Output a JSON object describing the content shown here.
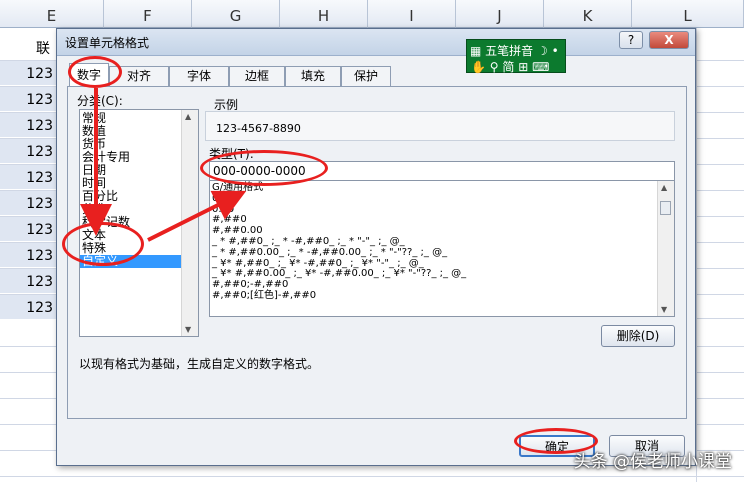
{
  "sheet": {
    "columns": [
      "E",
      "F",
      "G",
      "H",
      "I",
      "J",
      "K",
      "L"
    ],
    "header_cell": "联",
    "cells": [
      "123",
      "123",
      "123",
      "123",
      "123",
      "123",
      "123",
      "123",
      "123",
      "123"
    ]
  },
  "dialog": {
    "title": "设置单元格格式",
    "help_label": "?",
    "close_label": "X",
    "tabs": [
      "数字",
      "对齐",
      "字体",
      "边框",
      "填充",
      "保护"
    ],
    "category_label": "分类(C):",
    "categories": [
      "常规",
      "数值",
      "货币",
      "会计专用",
      "日期",
      "时间",
      "百分比",
      "分数",
      "科学记数",
      "文本",
      "特殊",
      "自定义"
    ],
    "selected_category": "自定义",
    "sample_label": "示例",
    "sample_value": "123-4567-8890",
    "type_label": "类型(T):",
    "type_value": "000-0000-0000",
    "format_list": [
      "G/通用格式",
      "0",
      "0.00",
      "#,##0",
      "#,##0.00",
      "_ * #,##0_ ;_ * -#,##0_ ;_ * \"-\"_ ;_ @_ ",
      "_ * #,##0.00_ ;_ * -#,##0.00_ ;_ * \"-\"??_ ;_ @_ ",
      "_ ¥* #,##0_ ;_ ¥* -#,##0_ ;_ ¥* \"-\"_ ;_ @_ ",
      "_ ¥* #,##0.00_ ;_ ¥* -#,##0.00_ ;_ ¥* \"-\"??_ ;_ @_ ",
      "#,##0;-#,##0",
      "#,##0;[红色]-#,##0"
    ],
    "delete_label": "删除(D)",
    "description": "以现有格式为基础，生成自定义的数字格式。",
    "ok_label": "确定",
    "cancel_label": "取消"
  },
  "ime": {
    "name": "五笔拼音",
    "mode": "简"
  },
  "watermark": "头条 @侯老师小课堂",
  "colors": {
    "annotation": "#e8201f",
    "selection": "#3399ff",
    "ime_bg": "#0c7a2e"
  }
}
